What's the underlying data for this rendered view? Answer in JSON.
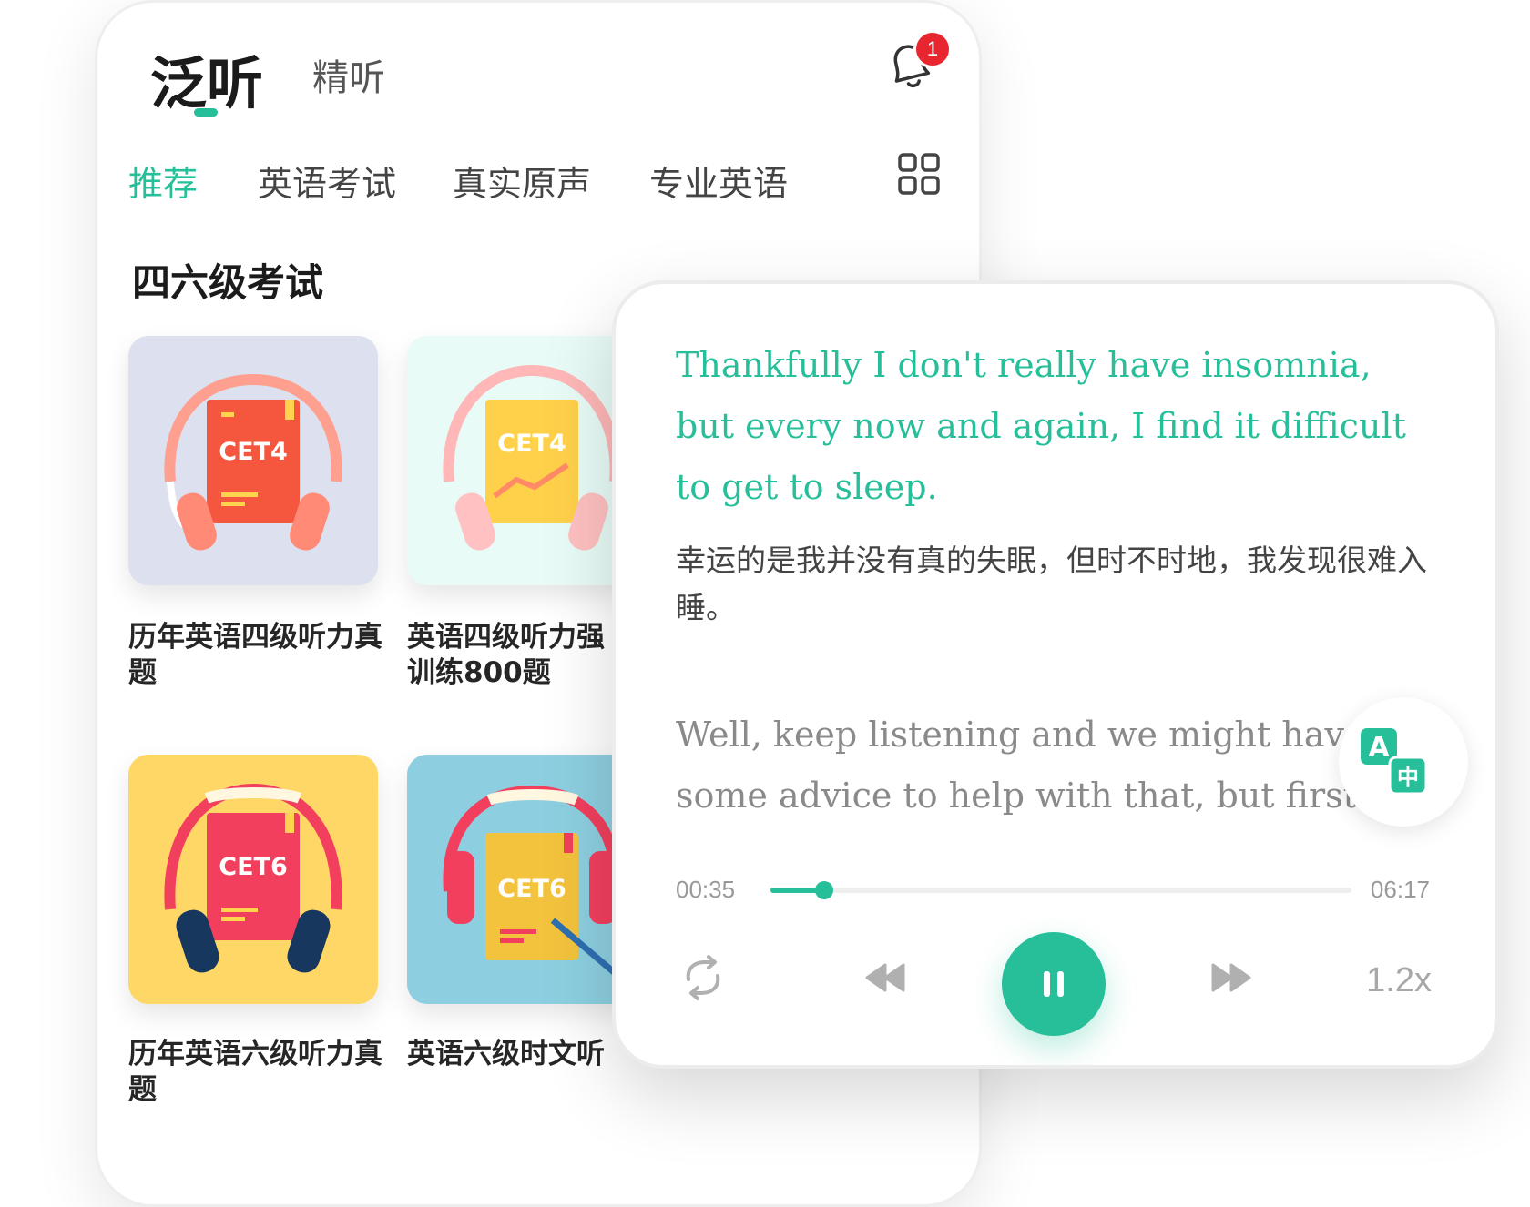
{
  "header": {
    "tabs": [
      {
        "label": "泛听",
        "active": true
      },
      {
        "label": "精听",
        "active": false
      }
    ],
    "notification_count": "1"
  },
  "categories": [
    "推荐",
    "英语考试",
    "真实原声",
    "专业英语"
  ],
  "section": {
    "title": "四六级考试",
    "cards": [
      {
        "badge": "CET4",
        "title": "历年英语四级听力真题",
        "bg": "#dde0ee"
      },
      {
        "badge": "CET4",
        "title": "英语四级听力强化训练800题",
        "title_shown": "英语四级听力强\n训练800题",
        "bg": "#e8fbf7"
      },
      {
        "badge": "CET6",
        "title": "历年英语六级听力真题",
        "bg": "#ffd766"
      },
      {
        "badge": "CET6",
        "title": "英语六级时文听",
        "bg": "#8dcfe0"
      }
    ]
  },
  "player": {
    "current_en": "Thankfully I don't really have insomnia, but every now and again, I find it difficult to get to sleep.",
    "current_zh": "幸运的是我并没有真的失眠，但时不时地，我发现很难入睡。",
    "next_en": "Well, keep listening and we might have some advice to help with that, but first",
    "time_current": "00:35",
    "time_total": "06:17",
    "progress_percent": 9.3,
    "speed": "1.2x",
    "state": "playing"
  },
  "colors": {
    "accent": "#26bf99",
    "badge": "#e8262f"
  }
}
